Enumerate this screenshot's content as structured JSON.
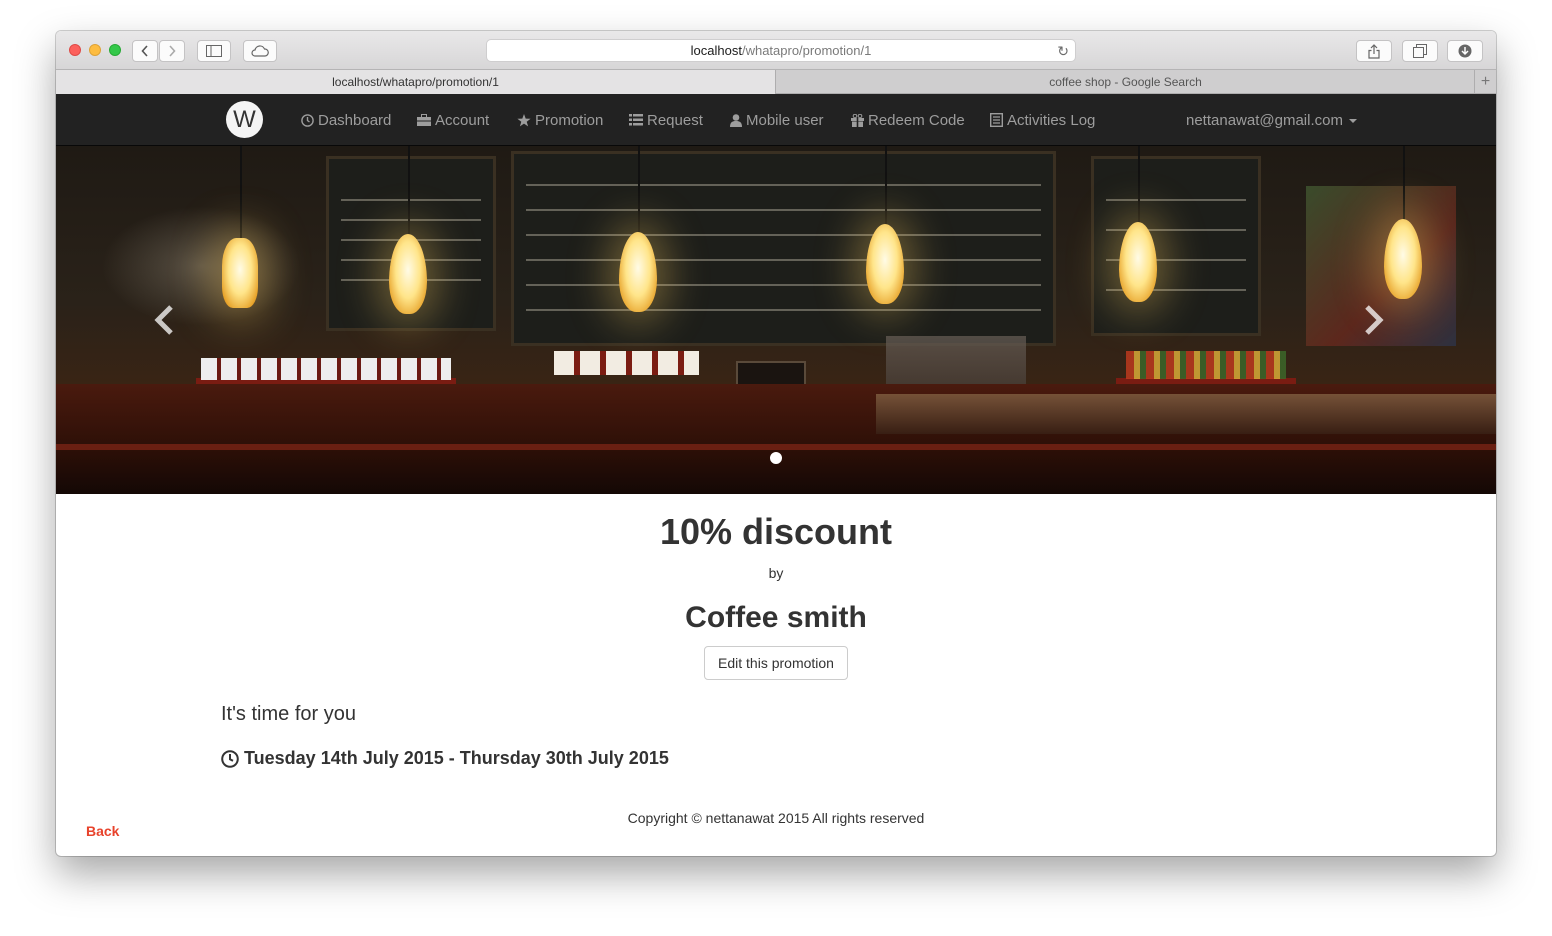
{
  "browser": {
    "url_host": "localhost",
    "url_path": "/whatapro/promotion/1",
    "tabs": [
      {
        "label": "localhost/whatapro/promotion/1"
      },
      {
        "label": "coffee shop - Google Search"
      }
    ]
  },
  "navbar": {
    "logo": "W",
    "items": [
      {
        "label": "Dashboard",
        "icon": "dashboard-icon"
      },
      {
        "label": "Account",
        "icon": "briefcase-icon"
      },
      {
        "label": "Promotion",
        "icon": "star-icon"
      },
      {
        "label": "Request",
        "icon": "list-icon"
      },
      {
        "label": "Mobile user",
        "icon": "user-icon"
      },
      {
        "label": "Redeem Code",
        "icon": "gift-icon"
      },
      {
        "label": "Activities Log",
        "icon": "list-alt-icon"
      }
    ],
    "user_email": "nettanawat@gmail.com"
  },
  "promotion": {
    "title": "10% discount",
    "by_label": "by",
    "shop_name": "Coffee smith",
    "edit_label": "Edit this promotion",
    "description": "It's time for you",
    "date_range": "Tuesday 14th July 2015 - Thursday 30th July 2015"
  },
  "footer": {
    "copyright": "Copyright © nettanawat 2015 All rights reserved",
    "back_label": "Back"
  },
  "colors": {
    "navbar_bg": "#222222",
    "navbar_text": "#9d9d9d",
    "back_link": "#e8432c"
  }
}
